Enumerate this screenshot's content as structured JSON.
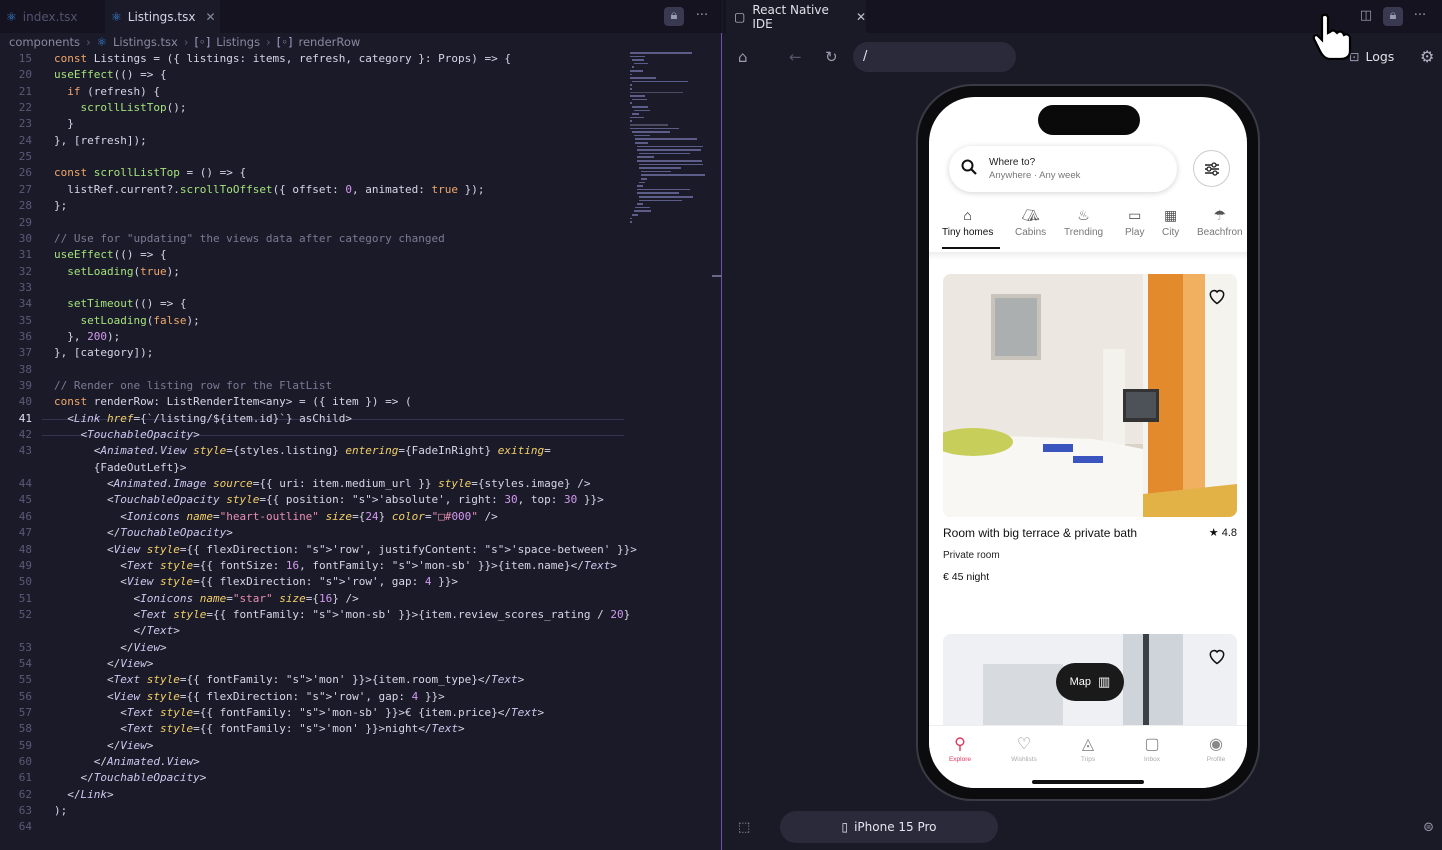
{
  "editor": {
    "tabs": [
      {
        "label": "index.tsx"
      },
      {
        "label": "Listings.tsx"
      }
    ],
    "breadcrumb": [
      "components",
      "Listings.tsx",
      "Listings",
      "renderRow"
    ],
    "current_line": "41",
    "lines": [
      {
        "n": "15",
        "text": "const Listings = ({ listings: items, refresh, category }: Props) => {"
      },
      {
        "n": "20",
        "text": "useEffect(() => {"
      },
      {
        "n": "21",
        "text": "  if (refresh) {"
      },
      {
        "n": "22",
        "text": "    scrollListTop();"
      },
      {
        "n": "23",
        "text": "  }"
      },
      {
        "n": "24",
        "text": "}, [refresh]);"
      },
      {
        "n": "25",
        "text": ""
      },
      {
        "n": "26",
        "text": "const scrollListTop = () => {"
      },
      {
        "n": "27",
        "text": "  listRef.current?.scrollToOffset({ offset: 0, animated: true });"
      },
      {
        "n": "28",
        "text": "};"
      },
      {
        "n": "29",
        "text": ""
      },
      {
        "n": "30",
        "text": "// Use for \"updating\" the views data after category changed"
      },
      {
        "n": "31",
        "text": "useEffect(() => {"
      },
      {
        "n": "32",
        "text": "  setLoading(true);"
      },
      {
        "n": "33",
        "text": ""
      },
      {
        "n": "34",
        "text": "  setTimeout(() => {"
      },
      {
        "n": "35",
        "text": "    setLoading(false);"
      },
      {
        "n": "36",
        "text": "  }, 200);"
      },
      {
        "n": "37",
        "text": "}, [category]);"
      },
      {
        "n": "38",
        "text": ""
      },
      {
        "n": "39",
        "text": "// Render one listing row for the FlatList"
      },
      {
        "n": "40",
        "text": "const renderRow: ListRenderItem<any> = ({ item }) => ("
      },
      {
        "n": "41",
        "text": "  <Link href={`/listing/${item.id}`} asChild>"
      },
      {
        "n": "42",
        "text": "    <TouchableOpacity>"
      },
      {
        "n": "43",
        "text": "      <Animated.View style={styles.listing} entering={FadeInRight} exiting="
      },
      {
        "n": "",
        "text": "      {FadeOutLeft}>"
      },
      {
        "n": "44",
        "text": "        <Animated.Image source={{ uri: item.medium_url }} style={styles.image} />"
      },
      {
        "n": "45",
        "text": "        <TouchableOpacity style={{ position: 'absolute', right: 30, top: 30 }}>"
      },
      {
        "n": "46",
        "text": "          <Ionicons name=\"heart-outline\" size={24} color=\"□#000\" />"
      },
      {
        "n": "47",
        "text": "        </TouchableOpacity>"
      },
      {
        "n": "48",
        "text": "        <View style={{ flexDirection: 'row', justifyContent: 'space-between' }}>"
      },
      {
        "n": "49",
        "text": "          <Text style={{ fontSize: 16, fontFamily: 'mon-sb' }}>{item.name}</Text>"
      },
      {
        "n": "50",
        "text": "          <View style={{ flexDirection: 'row', gap: 4 }}>"
      },
      {
        "n": "51",
        "text": "            <Ionicons name=\"star\" size={16} />"
      },
      {
        "n": "52",
        "text": "            <Text style={{ fontFamily: 'mon-sb' }}>{item.review_scores_rating / 20}"
      },
      {
        "n": "",
        "text": "            </Text>"
      },
      {
        "n": "53",
        "text": "          </View>"
      },
      {
        "n": "54",
        "text": "        </View>"
      },
      {
        "n": "55",
        "text": "        <Text style={{ fontFamily: 'mon' }}>{item.room_type}</Text>"
      },
      {
        "n": "56",
        "text": "        <View style={{ flexDirection: 'row', gap: 4 }}>"
      },
      {
        "n": "57",
        "text": "          <Text style={{ fontFamily: 'mon-sb' }}>€ {item.price}</Text>"
      },
      {
        "n": "58",
        "text": "          <Text style={{ fontFamily: 'mon' }}>night</Text>"
      },
      {
        "n": "59",
        "text": "        </View>"
      },
      {
        "n": "60",
        "text": "      </Animated.View>"
      },
      {
        "n": "61",
        "text": "    </TouchableOpacity>"
      },
      {
        "n": "62",
        "text": "  </Link>"
      },
      {
        "n": "63",
        "text": ");"
      },
      {
        "n": "64",
        "text": ""
      }
    ]
  },
  "preview": {
    "tab_label": "React Native IDE",
    "url": "/",
    "logs_label": "Logs",
    "device_label": "iPhone 15 Pro",
    "app": {
      "search_title": "Where to?",
      "search_subtitle": "Anywhere · Any week",
      "categories": [
        {
          "label": "Tiny homes",
          "icon": "house-icon"
        },
        {
          "label": "Cabins",
          "icon": "cabin-icon"
        },
        {
          "label": "Trending",
          "icon": "fire-icon"
        },
        {
          "label": "Play",
          "icon": "gamepad-icon"
        },
        {
          "label": "City",
          "icon": "building-icon"
        },
        {
          "label": "Beachfron",
          "icon": "beach-icon"
        }
      ],
      "listing": {
        "title": "Room with big terrace & private bath",
        "rating": "4.8",
        "room_type": "Private room",
        "price": "€ 45 night"
      },
      "map_label": "Map",
      "tabs": [
        {
          "label": "Explore"
        },
        {
          "label": "Wishlists"
        },
        {
          "label": "Trips"
        },
        {
          "label": "Inbox"
        },
        {
          "label": "Profile"
        }
      ]
    }
  },
  "colors": {
    "accent": "#e0375d",
    "editor_bg": "#1b1a29",
    "divider": "#6d4fb0"
  }
}
